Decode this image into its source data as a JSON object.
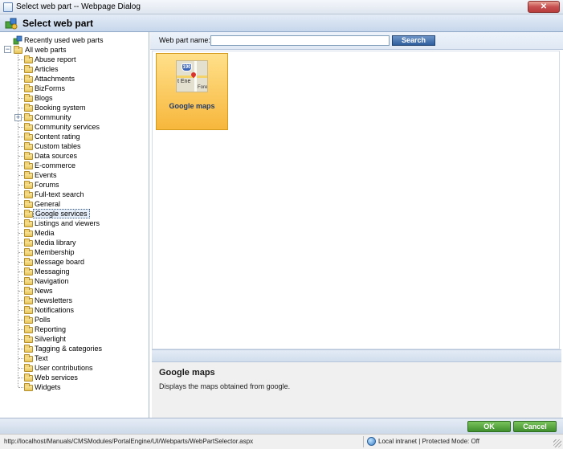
{
  "window": {
    "title": "Select web part -- Webpage Dialog",
    "close_label": "✕"
  },
  "header": {
    "title": "Select web part"
  },
  "tree": {
    "root_recent": "Recently used web parts",
    "root_all": "All web parts",
    "expand_glyph": "+",
    "selected": "Google services",
    "items": [
      "Abuse report",
      "Articles",
      "Attachments",
      "BizForms",
      "Blogs",
      "Booking system",
      "Community",
      "Community services",
      "Content rating",
      "Custom tables",
      "Data sources",
      "E-commerce",
      "Events",
      "Forums",
      "Full-text search",
      "General",
      "Google services",
      "Listings and viewers",
      "Media",
      "Media library",
      "Membership",
      "Message board",
      "Messaging",
      "Navigation",
      "News",
      "Newsletters",
      "Notifications",
      "Polls",
      "Reporting",
      "Silverlight",
      "Tagging & categories",
      "Text",
      "User contributions",
      "Web services",
      "Widgets"
    ]
  },
  "search": {
    "label": "Web part name:",
    "value": "",
    "placeholder": "",
    "button_label": "Search"
  },
  "webparts": [
    {
      "name": "Google maps",
      "icon": "map-icon",
      "selected": true
    }
  ],
  "thumb_text": {
    "shield": "190",
    "t1": "t Ene",
    "t2": "Fore"
  },
  "description": {
    "title": "Google maps",
    "text": "Displays the maps obtained from google."
  },
  "footer": {
    "ok_label": "OK",
    "cancel_label": "Cancel"
  },
  "statusbar": {
    "url": "http://localhost/Manuals/CMSModules/PortalEngine/UI/Webparts/WebPartSelector.aspx",
    "zone": "Local intranet | Protected Mode: Off"
  },
  "colors": {
    "accent": "#2f5f9e",
    "card_selected": "#f7b73c",
    "ok_button": "#3f8f2d"
  }
}
